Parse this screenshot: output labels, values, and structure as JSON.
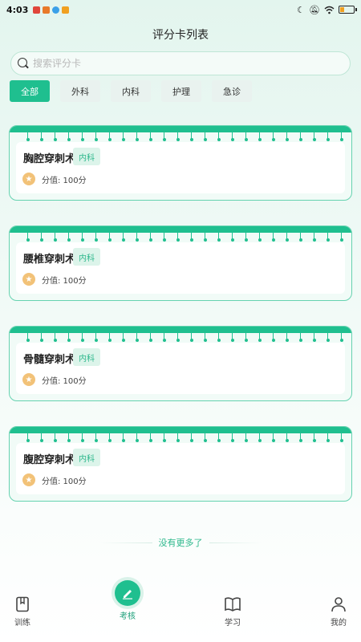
{
  "status_bar": {
    "time": "4:03"
  },
  "header": {
    "title": "评分卡列表"
  },
  "search": {
    "placeholder": "搜索评分卡"
  },
  "filters": [
    "全部",
    "外科",
    "内科",
    "护理",
    "急诊"
  ],
  "cards": [
    {
      "name": "胸腔穿刺术",
      "tag": "内科",
      "score": "分值: 100分"
    },
    {
      "name": "腰椎穿刺术",
      "tag": "内科",
      "score": "分值: 100分"
    },
    {
      "name": "骨髓穿刺术",
      "tag": "内科",
      "score": "分值: 100分"
    },
    {
      "name": "腹腔穿刺术",
      "tag": "内科",
      "score": "分值: 100分"
    }
  ],
  "footer_note": "没有更多了",
  "tabs": [
    {
      "label": "训练",
      "icon": "bookmark-icon"
    },
    {
      "label": "考核",
      "icon": "pencil-icon"
    },
    {
      "label": "学习",
      "icon": "book-icon"
    },
    {
      "label": "我的",
      "icon": "person-icon"
    }
  ],
  "colors": {
    "accent": "#1fbf8f",
    "tag_bg": "#dcf4ea",
    "star": "#f2c278"
  }
}
